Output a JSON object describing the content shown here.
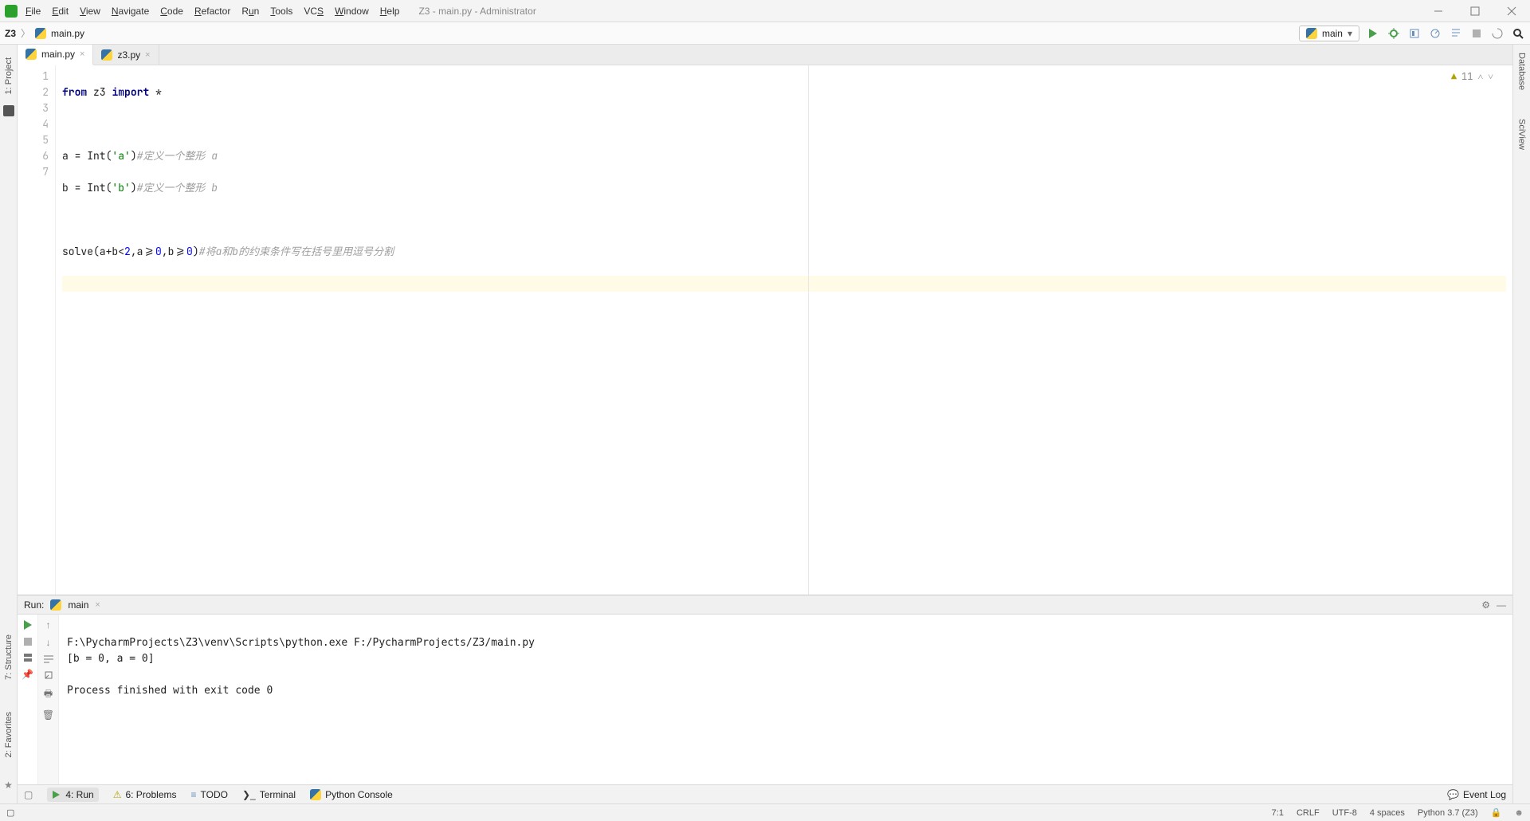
{
  "window": {
    "title": "Z3 - main.py - Administrator"
  },
  "menus": [
    "File",
    "Edit",
    "View",
    "Navigate",
    "Code",
    "Refactor",
    "Run",
    "Tools",
    "VCS",
    "Window",
    "Help"
  ],
  "breadcrumb": {
    "project": "Z3",
    "file": "main.py"
  },
  "runconfig": {
    "name": "main"
  },
  "tabs": [
    {
      "name": "main.py",
      "active": true
    },
    {
      "name": "z3.py",
      "active": false
    }
  ],
  "inspection": {
    "warnings": "11"
  },
  "code": {
    "lines": [
      "1",
      "2",
      "3",
      "4",
      "5",
      "6",
      "7"
    ],
    "l1_kw1": "from",
    "l1_mod": "z3",
    "l1_kw2": "import",
    "l1_star": "*",
    "l3_pre": "a = Int(",
    "l3_str": "'a'",
    "l3_post": ")",
    "l3_cmt": "#定义一个整形 a",
    "l4_pre": "b = Int(",
    "l4_str": "'b'",
    "l4_post": ")",
    "l4_cmt": "#定义一个整形 b",
    "l6_pre": "solve(a+b<",
    "l6_n1": "2",
    "l6_mid": ",a>=",
    "l6_n2": "0",
    "l6_mid2": ",b>=",
    "l6_n3": "0",
    "l6_post": ")",
    "l6_cmt": "#将a和b的约束条件写在括号里用逗号分割"
  },
  "run": {
    "title": "Run:",
    "config": "main",
    "out1": "F:\\PycharmProjects\\Z3\\venv\\Scripts\\python.exe F:/PycharmProjects/Z3/main.py",
    "out2": "[b = 0, a = 0]",
    "out3": "",
    "out4": "Process finished with exit code 0"
  },
  "bottomTabs": {
    "run": "4: Run",
    "problems": "6: Problems",
    "todo": "TODO",
    "terminal": "Terminal",
    "pyconsole": "Python Console",
    "eventlog": "Event Log"
  },
  "sideTools": {
    "project": "1: Project",
    "structure": "7: Structure",
    "favorites": "2: Favorites",
    "database": "Database",
    "sciview": "SciView"
  },
  "status": {
    "pos": "7:1",
    "eol": "CRLF",
    "enc": "UTF-8",
    "indent": "4 spaces",
    "interp": "Python 3.7 (Z3)"
  }
}
